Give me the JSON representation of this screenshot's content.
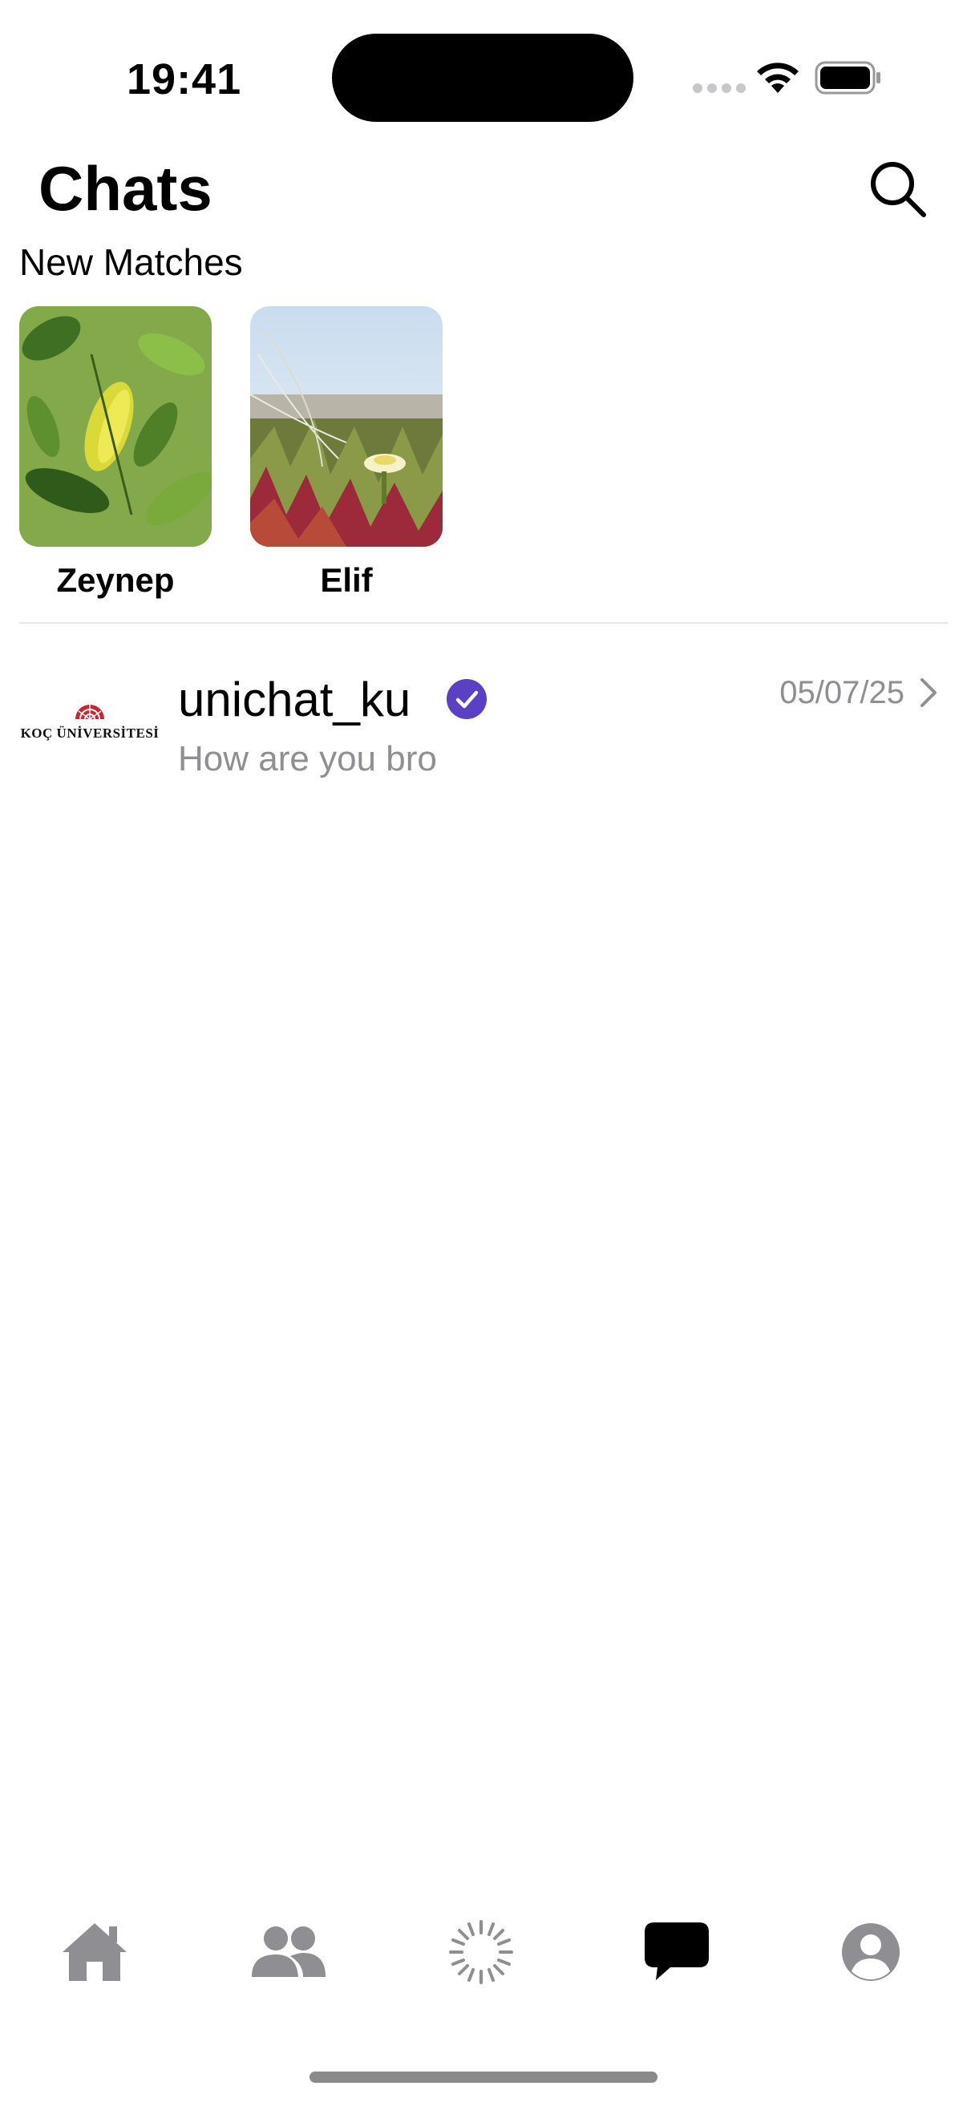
{
  "status_bar": {
    "time": "19:41"
  },
  "header": {
    "title": "Chats"
  },
  "new_matches": {
    "title": "New Matches",
    "items": [
      {
        "name": "Zeynep"
      },
      {
        "name": "Elif"
      }
    ]
  },
  "chats": [
    {
      "name": "unichat_ku",
      "avatar_label": "KOÇ ÜNİVERSİTESİ",
      "verified": true,
      "preview": "How are you bro",
      "date": "05/07/25"
    }
  ],
  "tab_bar": {
    "tabs": [
      {
        "icon": "home-icon",
        "active": false
      },
      {
        "icon": "people-icon",
        "active": false
      },
      {
        "icon": "spinner-icon",
        "active": false
      },
      {
        "icon": "chat-bubble-icon",
        "active": true
      },
      {
        "icon": "profile-icon",
        "active": false
      }
    ]
  },
  "colors": {
    "verified": "#5b3fc4",
    "secondary_text": "#8e8e93",
    "inactive_tab": "#8e8e93",
    "active_tab": "#000000",
    "logo_red": "#d3202f"
  }
}
